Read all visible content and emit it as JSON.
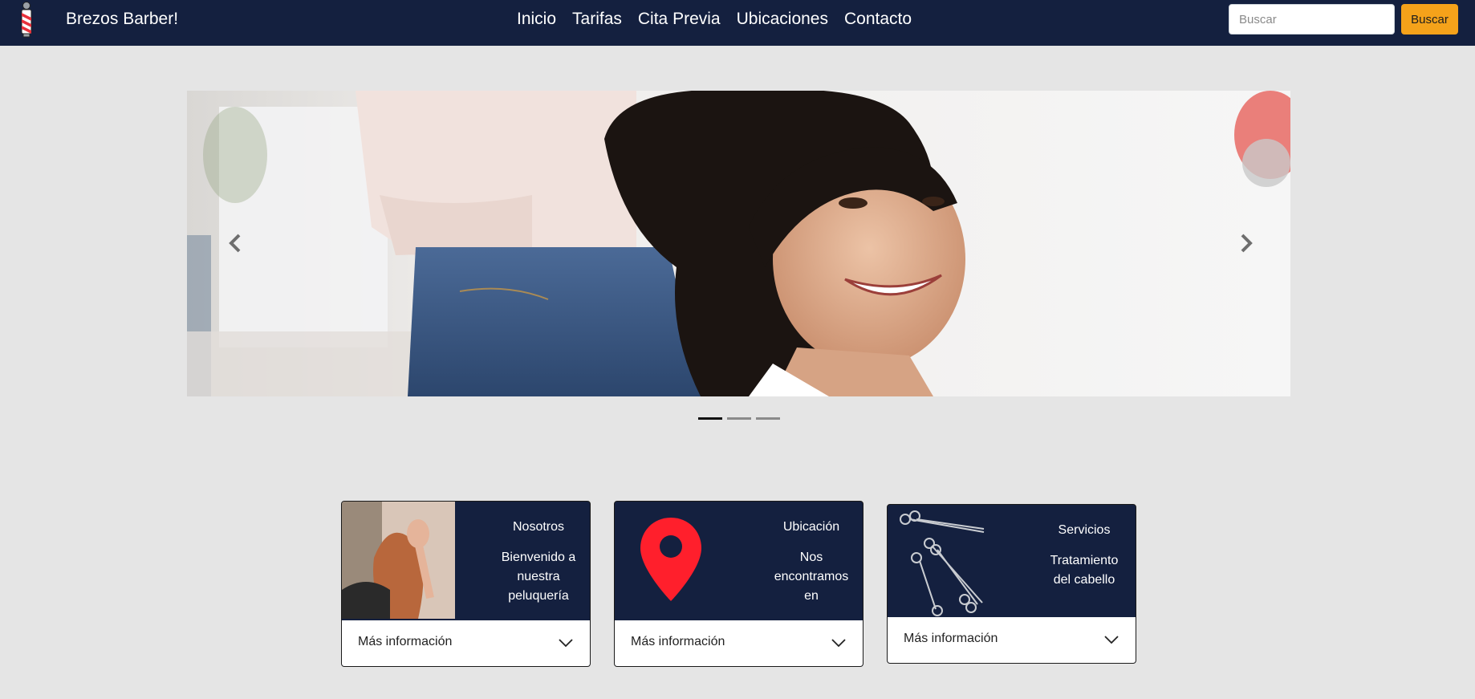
{
  "navbar": {
    "brand": "Brezos Barber!",
    "links": [
      "Inicio",
      "Tarifas",
      "Cita Previa",
      "Ubicaciones",
      "Contacto"
    ],
    "search_placeholder": "Buscar",
    "search_button": "Buscar"
  },
  "carousel": {
    "slide_count": 3,
    "active_index": 0,
    "prev_icon": "chevron-left-icon",
    "next_icon": "chevron-right-icon"
  },
  "cards": [
    {
      "title": "Nosotros",
      "text_lines": [
        "Bienvenido a",
        "nuestra",
        "peluquería"
      ],
      "footer": "Más información",
      "image": "hair-salon-photo"
    },
    {
      "title": "Ubicación",
      "text_lines": [
        "Nos",
        "encontramos",
        "en"
      ],
      "footer": "Más información",
      "image": "map-pin-icon"
    },
    {
      "title": "Servicios",
      "text_lines": [
        "Tratamiento",
        "del cabello"
      ],
      "footer": "Más información",
      "image": "scissors-photo"
    }
  ],
  "colors": {
    "navbar_bg": "#14203f",
    "accent": "#f5a21a",
    "pin": "#ff1f2c",
    "page_bg": "#e5e5e5"
  }
}
